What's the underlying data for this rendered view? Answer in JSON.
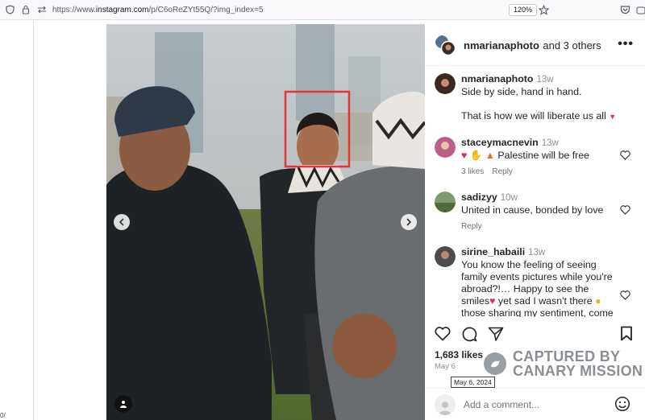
{
  "browser": {
    "url_prefix": "https://www.",
    "url_domain": "instagram.com",
    "url_path": "/p/C6oReZYt55Q/?img_index=5",
    "zoom": "120%",
    "left_cut_text": "0/"
  },
  "post": {
    "header_user": "nmarianaphoto",
    "header_rest": "and 3 others",
    "more_label": "•••",
    "caption": {
      "user": "nmarianaphoto",
      "time": "13w",
      "line1": "Side by side, hand in hand.",
      "line2": "That is how we will liberate us all"
    },
    "comments": [
      {
        "user": "staceymacnevin",
        "time": "13w",
        "text": "Palestine will be free",
        "likes": "3 likes",
        "reply": "Reply"
      },
      {
        "user": "sadizyy",
        "time": "10w",
        "text": "United in cause, bonded by love",
        "reply": "Reply"
      },
      {
        "user": "sirine_habaili",
        "time": "13w",
        "text_a": "You know the feeling of seeing family events pictures while you're abroad?!… Happy to see the smiles",
        "text_b": "yet sad I wasn't there",
        "text_c": "those sharing my sentiment, come take a seat next to"
      }
    ],
    "likes": "1,683 likes",
    "date": "May 6",
    "date_tooltip": "May 6, 2024",
    "add_comment_placeholder": "Add a comment...",
    "carousel_dots": 10,
    "carousel_active_index": 4
  },
  "watermark": {
    "line1": "CAPTURED BY",
    "line2": "CANARY MISSION"
  },
  "colors": {
    "accent_red": "#e0245e",
    "highlight_box": "#e0353a"
  }
}
